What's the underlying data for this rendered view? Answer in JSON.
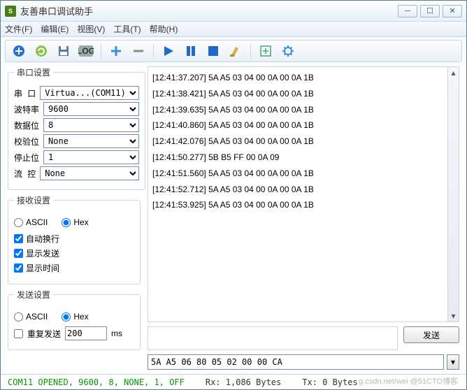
{
  "window": {
    "title": "友善串口调试助手"
  },
  "menu": {
    "file": "文件(F)",
    "edit": "编辑(E)",
    "view": "视图(V)",
    "tools": "工具(T)",
    "help": "帮助(H)"
  },
  "left": {
    "port_section": "串口设置",
    "port_label": "串  口",
    "port_value": "Virtua...(COM11)",
    "baud_label": "波特率",
    "baud_value": "9600",
    "data_label": "数据位",
    "data_value": "8",
    "parity_label": "校验位",
    "parity_value": "None",
    "stop_label": "停止位",
    "stop_value": "1",
    "flow_label": "流  控",
    "flow_value": "None",
    "recv_section": "接收设置",
    "recv_ascii": "ASCII",
    "recv_hex": "Hex",
    "auto_wrap": "自动换行",
    "show_tx": "显示发送",
    "show_time": "显示时间",
    "send_section": "发送设置",
    "send_ascii": "ASCII",
    "send_hex": "Hex",
    "repeat_label": "重复发送",
    "repeat_value": "200",
    "repeat_unit": "ms"
  },
  "log_lines": [
    "[12:41:37.207] 5A A5 03 04 00 0A 00 0A 1B",
    "[12:41:38.421] 5A A5 03 04 00 0A 00 0A 1B",
    "[12:41:39.635] 5A A5 03 04 00 0A 00 0A 1B",
    "[12:41:40.860] 5A A5 03 04 00 0A 00 0A 1B",
    "[12:41:42.076] 5A A5 03 04 00 0A 00 0A 1B",
    "[12:41:50.277] 5B B5 FF 00 0A 09",
    "[12:41:51.560] 5A A5 03 04 00 0A 00 0A 1B",
    "[12:41:52.712] 5A A5 03 04 00 0A 00 0A 1B",
    "[12:41:53.925] 5A A5 03 04 00 0A 00 0A 1B"
  ],
  "send": {
    "button": "发送",
    "hex_input": "5A A5 06 80 05 02 00 00 CA"
  },
  "status": {
    "main": "COM11 OPENED, 9600, 8, NONE, 1, OFF",
    "rx": "Rx: 1,086 Bytes",
    "tx": "Tx: 0 Bytes"
  },
  "watermark": "g.csdn.net/wei @51CTO博客"
}
